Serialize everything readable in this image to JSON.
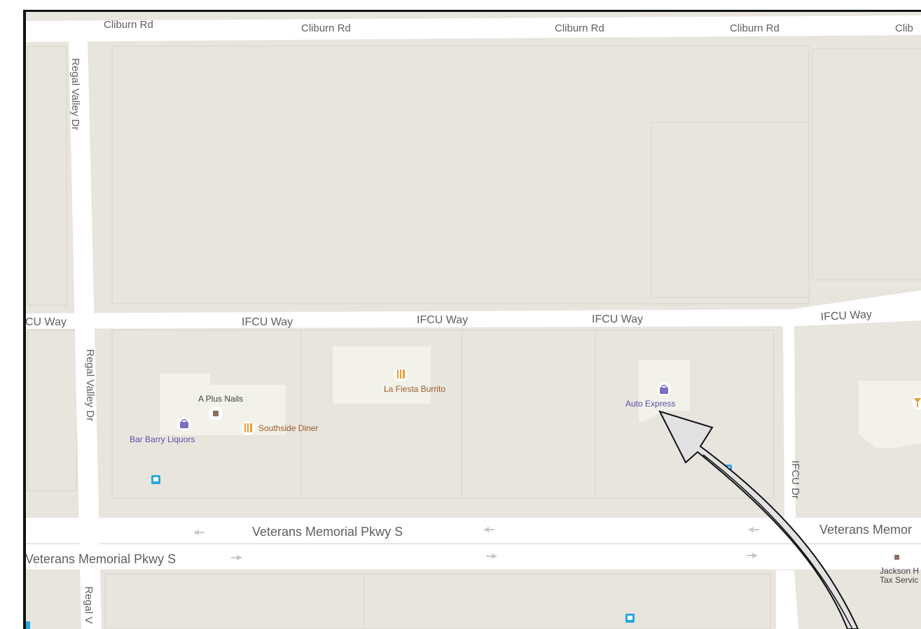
{
  "map": {
    "colors": {
      "land": "#e8e4de",
      "block_edge": "#d9d4cc",
      "building": "#f2f1ea",
      "road": "#ffffff",
      "label": "#5f5f5f",
      "shop_purple": "#7b6fc0",
      "food_orange": "#f29b30",
      "transit_blue": "#28a8e0",
      "food_label": "#9a5b2d",
      "shop_label": "#5a4fa3",
      "frame": "#111111"
    },
    "streets": {
      "cliburn_1": "Cliburn Rd",
      "cliburn_2": "Cliburn Rd",
      "cliburn_3": "Cliburn Rd",
      "cliburn_4": "Cliburn Rd",
      "cliburn_5": "Clib",
      "ifcu_1": "CU Way",
      "ifcu_2": "IFCU Way",
      "ifcu_3": "IFCU Way",
      "ifcu_4": "IFCU Way",
      "ifcu_5": "IFCU Way",
      "regal_1": "Regal Valley Dr",
      "regal_2": "Regal Valley Dr",
      "regal_3": "Regal V",
      "ifcu_dr": "IFCU Dr",
      "vet_1": "Veterans Memorial Pkwy S",
      "vet_2": "Veterans Memor",
      "vet_3": "Veterans Memorial Pkwy S"
    },
    "pois": {
      "a_plus_nails": "A Plus Nails",
      "bar_barry": "Bar Barry Liquors",
      "southside": "Southside Diner",
      "la_fiesta": "La Fiesta Burrito",
      "auto_express": "Auto Express",
      "jackson_1": "Jackson H",
      "jackson_2": "Tax Servic"
    },
    "icons": {
      "shop": "shopping-bag-icon",
      "food": "fork-knife-icon",
      "generic": "square-pin-icon",
      "transit": "bus-stop-icon",
      "cursor": "arrow-pointer-icon"
    }
  }
}
